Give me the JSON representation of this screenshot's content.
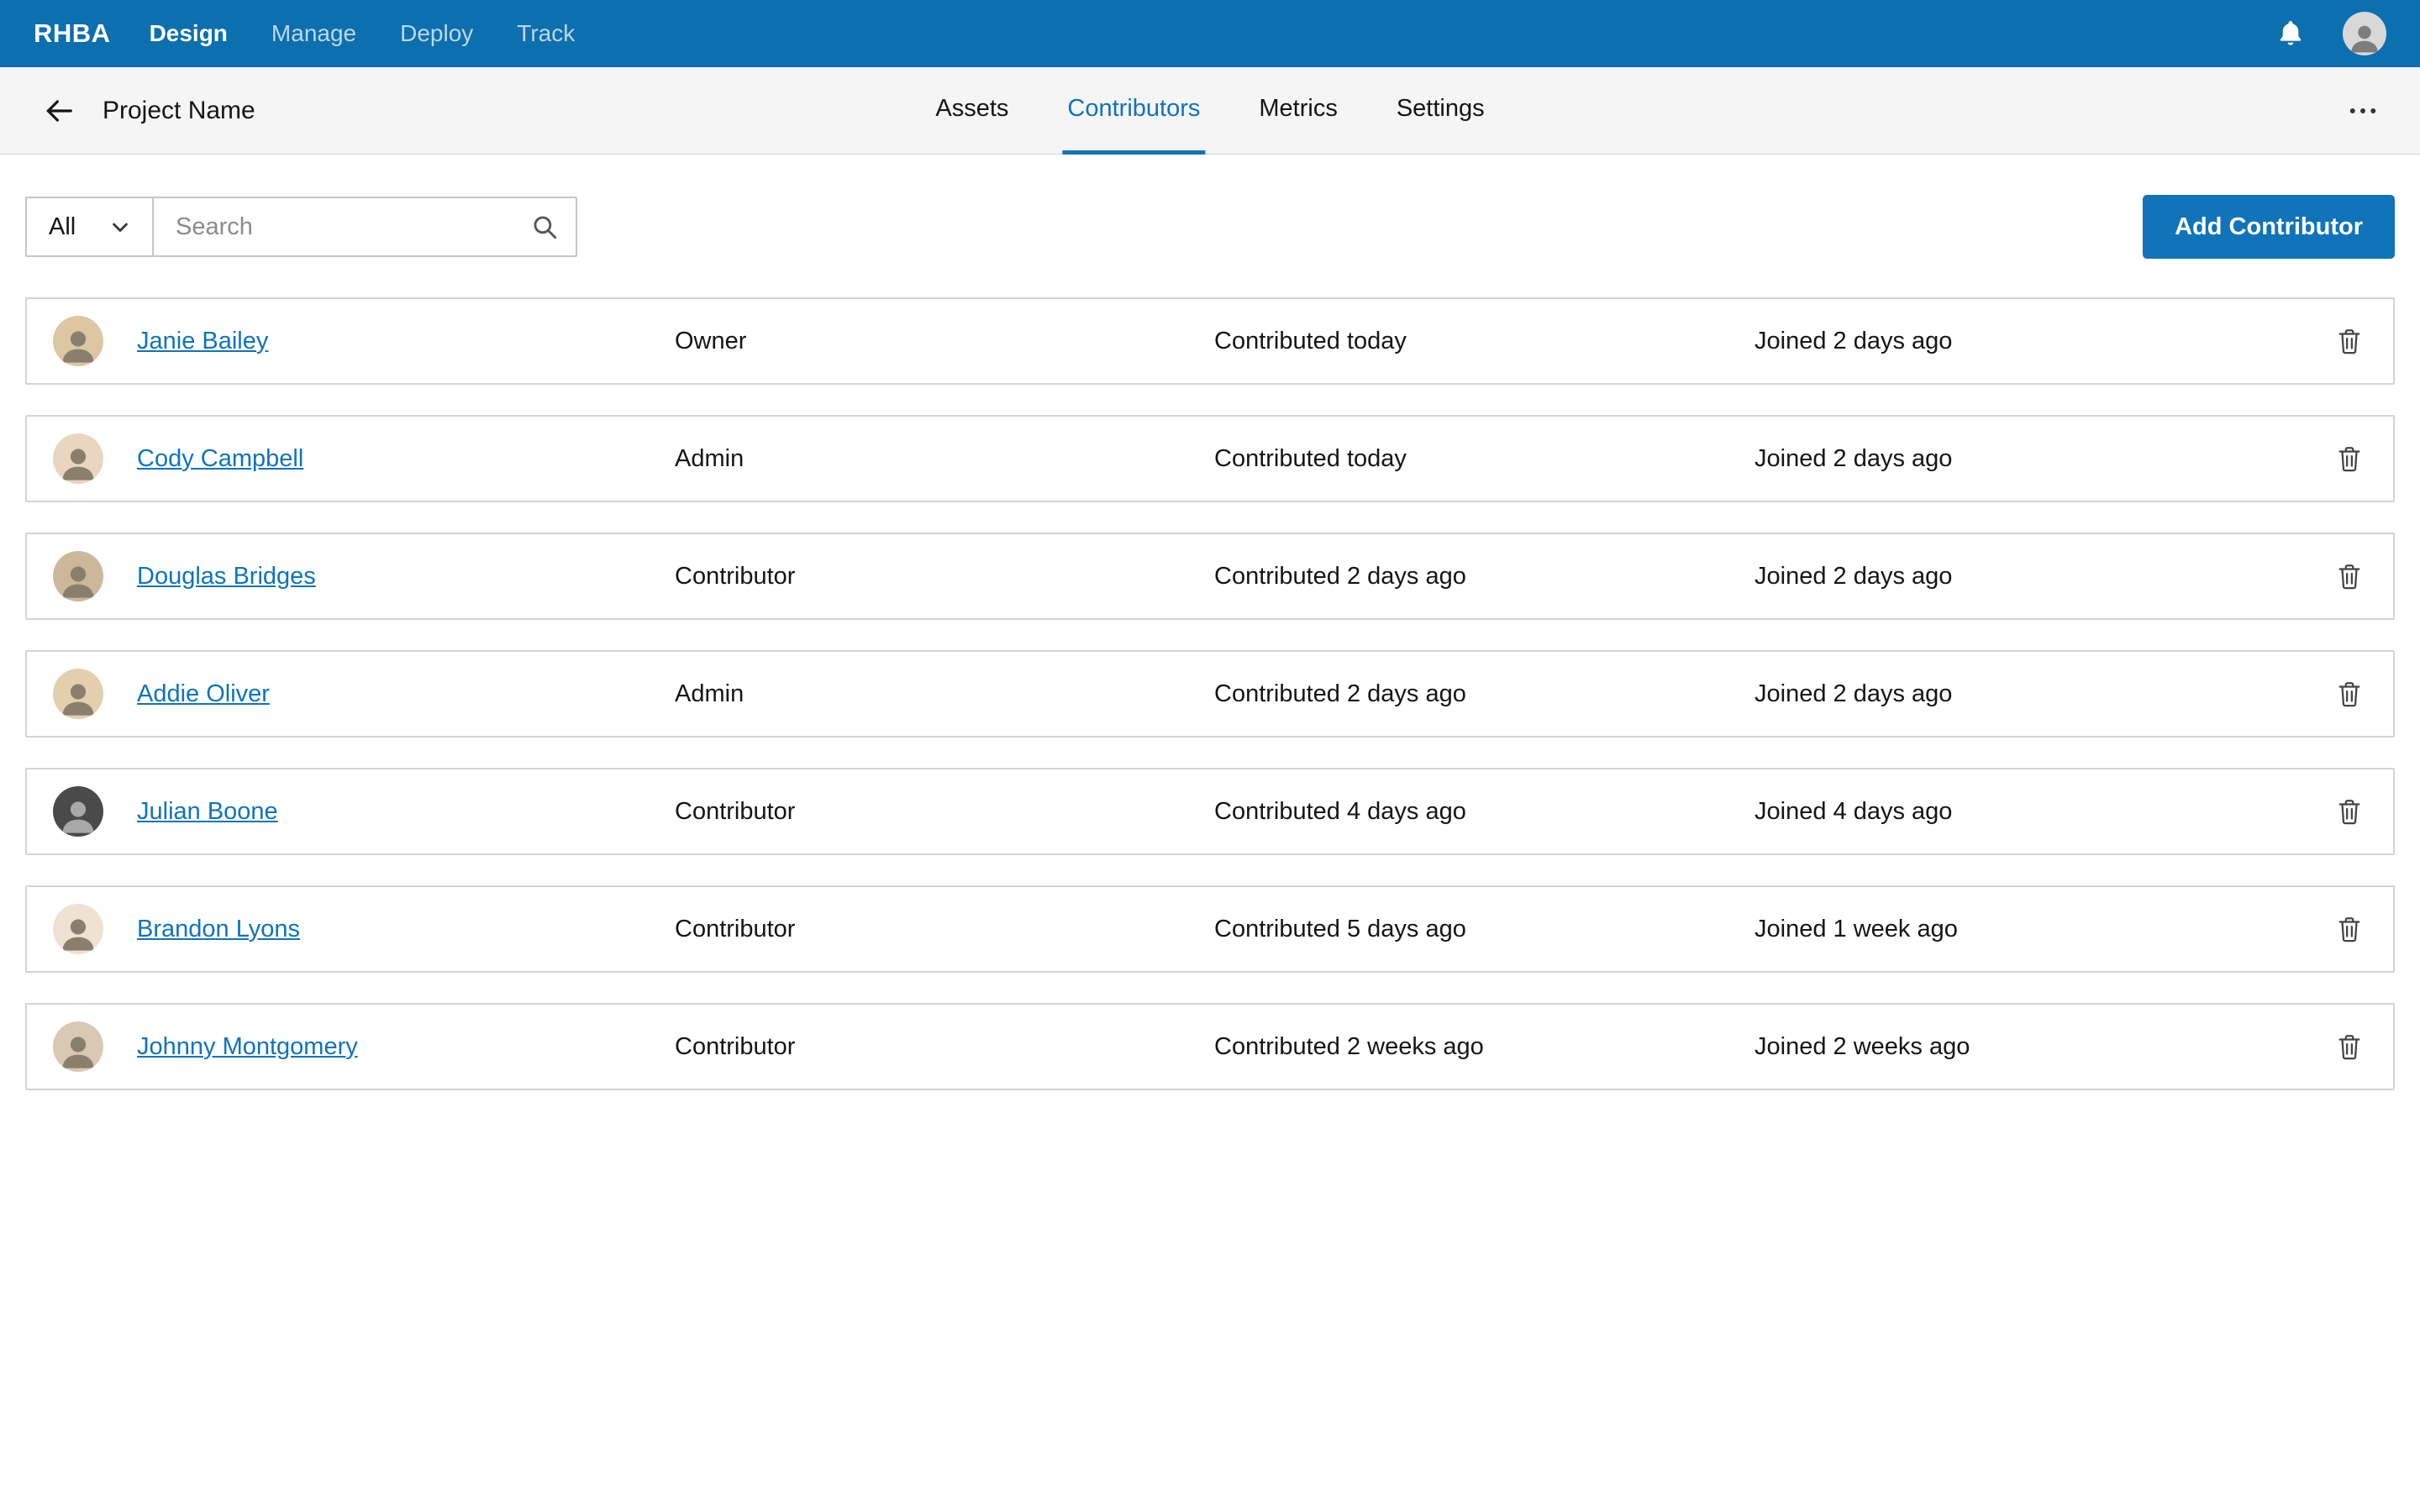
{
  "colors": {
    "navbar_blue": "#0c6fae",
    "primary_blue": "#1173ba",
    "link_blue": "#1173ba",
    "header_gray": "#f5f5f5"
  },
  "topnav": {
    "brand": "RHBA",
    "items": [
      {
        "label": "Design",
        "active": true
      },
      {
        "label": "Manage",
        "active": false
      },
      {
        "label": "Deploy",
        "active": false
      },
      {
        "label": "Track",
        "active": false
      }
    ]
  },
  "header": {
    "title": "Project Name",
    "tabs": [
      {
        "label": "Assets",
        "active": false
      },
      {
        "label": "Contributors",
        "active": true
      },
      {
        "label": "Metrics",
        "active": false
      },
      {
        "label": "Settings",
        "active": false
      }
    ]
  },
  "toolbar": {
    "filter_value": "All",
    "search_placeholder": "Search",
    "add_button_label": "Add Contributor"
  },
  "contributors": [
    {
      "name": "Janie Bailey",
      "role": "Owner",
      "contributed": "Contributed today",
      "joined": "Joined 2 days ago"
    },
    {
      "name": "Cody Campbell",
      "role": "Admin",
      "contributed": "Contributed today",
      "joined": "Joined 2 days ago"
    },
    {
      "name": "Douglas Bridges",
      "role": "Contributor",
      "contributed": "Contributed 2 days ago",
      "joined": "Joined 2 days ago"
    },
    {
      "name": "Addie Oliver",
      "role": "Admin",
      "contributed": "Contributed 2 days ago",
      "joined": "Joined 2 days ago"
    },
    {
      "name": "Julian Boone",
      "role": "Contributor",
      "contributed": "Contributed 4 days ago",
      "joined": "Joined 4 days ago"
    },
    {
      "name": "Brandon Lyons",
      "role": "Contributor",
      "contributed": "Contributed 5 days ago",
      "joined": "Joined 1 week ago"
    },
    {
      "name": "Johnny Montgomery",
      "role": "Contributor",
      "contributed": "Contributed 2 weeks ago",
      "joined": "Joined 2 weeks ago"
    }
  ],
  "icons": {
    "notifications": "bell",
    "user_menu": "avatar",
    "back": "arrow-left",
    "overflow_menu": "kebab-horizontal",
    "filter": "chevron-down",
    "search": "magnifier",
    "delete": "trash"
  }
}
